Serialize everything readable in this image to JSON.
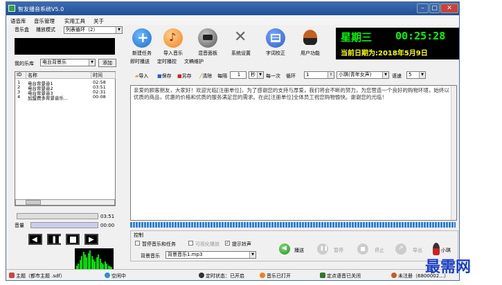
{
  "window": {
    "title": "智友播音系统V5.0"
  },
  "menu": [
    "语音库",
    "音乐管理",
    "实用工具",
    "关于"
  ],
  "left": {
    "tabs": [
      "音乐盒",
      "播放模式"
    ],
    "play_mode_value": "列表循环（2）",
    "my_library_label": "我的乐库",
    "library_value": "电台背景乐",
    "add_button": "添加",
    "list_headers": [
      "ID",
      "名称",
      "时间"
    ],
    "tracks": [
      {
        "id": "1",
        "name": "电台背景音1",
        "time": "02:58"
      },
      {
        "id": "2",
        "name": "电台背景音2",
        "time": "03:51"
      },
      {
        "id": "3",
        "name": "电台背景音3",
        "time": "02:31"
      },
      {
        "id": "4",
        "name": "加盟费多背景音乐...",
        "time": "00:08"
      }
    ],
    "seek_time": "03:51",
    "volume_label": "音量",
    "volume_time": "00:00"
  },
  "toolbar": [
    {
      "label": "新建任务",
      "icon": "plus-icon",
      "color": "#1f6fc9"
    },
    {
      "label": "导入音乐",
      "icon": "music-note-icon",
      "color": "#f08020"
    },
    {
      "label": "混音面板",
      "icon": "mixer-icon",
      "color": "#6a6a6a"
    },
    {
      "label": "系统设置",
      "icon": "tools-icon",
      "color": "#7a7a7a"
    },
    {
      "label": "字词校正",
      "icon": "grid-icon",
      "color": "#2b5fc2"
    },
    {
      "label": "用户功能",
      "icon": "user-icon",
      "color": "#c46020"
    }
  ],
  "clock": {
    "day": "星期三",
    "time": "00:25:28",
    "date": "当前日期为:2018年5月9日"
  },
  "panel_tabs": [
    "即时播送",
    "定时播控",
    "文稿维护"
  ],
  "options": {
    "import": "导入",
    "save": "保存",
    "save_as": "另存",
    "clear": "清除",
    "every_label": "每隔",
    "every_value": "1",
    "unit_value": "秒",
    "every_once": "每一次",
    "loop_label": "循环",
    "loop_value": "1",
    "voice_value": "小琪(青年女声)",
    "speed_label": "语速",
    "speed_value": "5"
  },
  "text_content": "亲爱的顾客朋友，大家好！欢迎光临[注册单位]，为了感谢您的支持与厚爱，我们将会不断的努力，为您营造一个良好的购物环境，始终以优质的商品，优惠的价格和优质的服务满足您的需求。在此[注册单位]全体员工祝您购物愉快。谢谢您的光临！",
  "control": {
    "group_label": "控制",
    "check_pause_music": "暂停音乐和任务",
    "check_visualize": "可视化播放",
    "check_tip": "提示铃声",
    "bg_music_label": "背景音乐",
    "bg_music_value": "背景音乐1.mp3",
    "broadcast": "播送",
    "pause": "暂停",
    "stop": "停止",
    "export": "导出",
    "voice_name": "小琪"
  },
  "status": {
    "theme": "主题（都市主题 .sdf）",
    "idle": "空闲中",
    "timer": "定时状态：已开启",
    "music": "音乐已打开",
    "timed_voice": "定点语音已关闭",
    "register": "未注册（6800002…）"
  },
  "watermark": "最需网"
}
